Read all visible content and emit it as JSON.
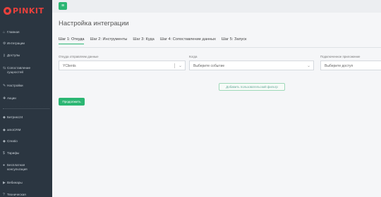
{
  "brand": {
    "logo_text": "PINKIT"
  },
  "topbar": {
    "menu_icon": "hamburger-icon"
  },
  "sidebar": {
    "items": [
      {
        "label": "Главная",
        "icon": "home-icon",
        "glyph": "⌂"
      },
      {
        "label": "Интеграции",
        "icon": "gear-icon",
        "glyph": "⚙"
      },
      {
        "label": "Доступы",
        "icon": "key-icon",
        "glyph": "⚷"
      },
      {
        "label": "Сопоставление сущностей",
        "icon": "link-icon",
        "glyph": "⇆"
      },
      {
        "label": "Настройки",
        "icon": "wrench-icon",
        "glyph": "✎"
      },
      {
        "label": "Акции",
        "icon": "gift-icon",
        "glyph": "✚"
      },
      {
        "label": "Битрикс24",
        "icon": "puzzle-icon",
        "glyph": "◆"
      },
      {
        "label": "amoCRM",
        "icon": "puzzle-icon",
        "glyph": "◆"
      },
      {
        "label": "Creatio",
        "icon": "puzzle-icon",
        "glyph": "◆"
      },
      {
        "label": "Тарифы",
        "icon": "dollar-icon",
        "glyph": "$"
      },
      {
        "label": "Бесплатная консультация",
        "icon": "user-icon",
        "glyph": "●"
      },
      {
        "label": "Вебинары",
        "icon": "video-icon",
        "glyph": "▶"
      },
      {
        "label": "Техническая",
        "icon": "support-icon",
        "glyph": "?"
      }
    ]
  },
  "main": {
    "title": "Настройка интеграции",
    "tabs": [
      {
        "label": "Шаг 1: Откуда"
      },
      {
        "label": "Шаг 2: Инструменты"
      },
      {
        "label": "Шаг 3: Куда"
      },
      {
        "label": "Шаг 4: Сопоставление данных"
      },
      {
        "label": "Шаг 5: Запуск"
      }
    ],
    "fields": {
      "source": {
        "label": "Откуда отправляем данные",
        "value": "YClients"
      },
      "when": {
        "label": "Когда",
        "value": "Выберите событие"
      },
      "app": {
        "label": "Подключенное приложение",
        "value": "Выберите доступ"
      }
    },
    "add_filter_label": "Добавить пользовательский фильтр",
    "continue_label": "Продолжить"
  },
  "colors": {
    "accent": "#2bb673",
    "sidebar_bg": "#2b3641",
    "brand": "#e8413c"
  }
}
